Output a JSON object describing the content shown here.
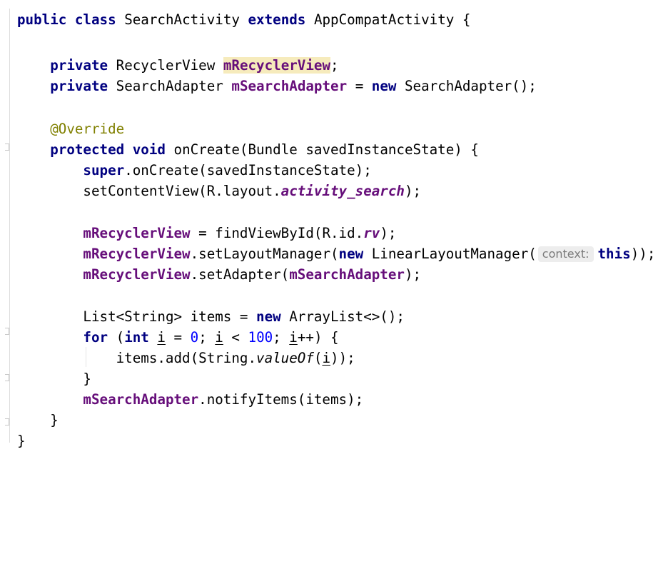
{
  "editor": {
    "lines": {
      "l1": {
        "kw1": "public",
        "kw2": "class",
        "name": "SearchActivity",
        "kw3": "extends",
        "rest": "AppCompatActivity {"
      },
      "l2": {
        "kw": "private",
        "type": "RecyclerView",
        "field": "mRecyclerView",
        "tail": ";"
      },
      "l3": {
        "kw": "private",
        "type": "SearchAdapter",
        "field": "mSearchAdapter",
        "eq": " = ",
        "kw2": "new",
        "rest": " SearchAdapter();"
      },
      "l4": {
        "ann": "@Override"
      },
      "l5": {
        "kw1": "protected",
        "kw2": "void",
        "rest": " onCreate(Bundle savedInstanceState) {"
      },
      "l6": {
        "kw": "super",
        "rest": ".onCreate(savedInstanceState);"
      },
      "l7": {
        "pre": "setContentView(R.layout.",
        "field": "activity_search",
        "tail": ");"
      },
      "l8": {
        "field": "mRecyclerView",
        "pre": " = findViewById(R.id.",
        "field2": "rv",
        "tail": ");"
      },
      "l9": {
        "field": "mRecyclerView",
        "pre": ".setLayoutManager(",
        "kw": "new",
        "mid": " LinearLayoutManager(",
        "hint": "context:",
        "kw2": "this",
        "tail": "));"
      },
      "l10": {
        "field": "mRecyclerView",
        "pre": ".setAdapter(",
        "field2": "mSearchAdapter",
        "tail": ");"
      },
      "l11": {
        "pre": "List<String> items = ",
        "kw": "new",
        "tail": " ArrayList<>();"
      },
      "l12": {
        "kw": "for",
        "p1": " (",
        "kw2": "int",
        "v1": "i",
        "p2": " = ",
        "n1": "0",
        "p3": "; ",
        "v2": "i",
        "p4": " < ",
        "n2": "100",
        "p5": "; ",
        "v3": "i",
        "p6": "++) {"
      },
      "l13": {
        "pre": "items.add(String.",
        "method": "valueOf",
        "p1": "(",
        "v": "i",
        "tail": "));"
      },
      "l14": {
        "text": "}"
      },
      "l15": {
        "field": "mSearchAdapter",
        "tail": ".notifyItems(items);"
      },
      "l16": {
        "text": "}"
      },
      "l17": {
        "text": "}"
      }
    }
  }
}
